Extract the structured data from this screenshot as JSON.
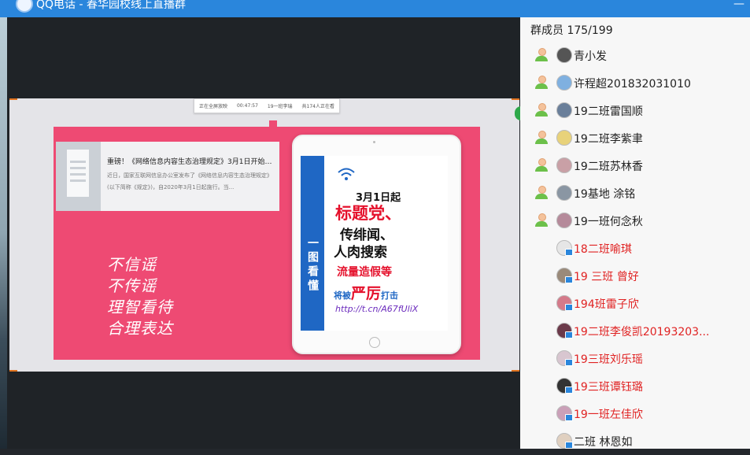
{
  "window": {
    "title": "QQ电话 - 春华园校线上直播群",
    "minimize_glyph": "—"
  },
  "slide": {
    "top_info": [
      "正在全屏放映",
      "00:47:57",
      "19一班李瑞",
      "共174人正在看"
    ],
    "article": {
      "title": "重磅！《网络信息内容生态治理规定》3月1日开始施...",
      "text": "近日，国家互联网信息办公室发布了《网络信息内容生态治理规定》(以下简称《规定》)，自2020年3月1日起施行。当..."
    },
    "handwriting": [
      "不信谣",
      "不传谣",
      "理智看待",
      "合理表达"
    ],
    "banner": "一图看懂",
    "poster": {
      "line1": "3月1日起",
      "line2": "标题党、",
      "line3": "传绯闻、",
      "line4": "人肉搜索",
      "line5": "流量造假等",
      "line6a": "将被",
      "line6b": "严厉",
      "line6c": "打击",
      "url": "http://t.cn/A67fUliX"
    }
  },
  "sidebar": {
    "header": "群成员 175/199",
    "members": [
      {
        "name": "青小发",
        "owner": true,
        "color": "#222222",
        "avatar_color": "#555555"
      },
      {
        "name": "许程超201832031010",
        "owner": true,
        "color": "#222222",
        "avatar_color": "#7fb0e0"
      },
      {
        "name": "19二班雷国顺",
        "owner": true,
        "color": "#222222",
        "avatar_color": "#6a7f9a"
      },
      {
        "name": "19二班李紫聿",
        "owner": true,
        "color": "#222222",
        "avatar_color": "#e8d27a"
      },
      {
        "name": "19二班苏林香",
        "owner": true,
        "color": "#222222",
        "avatar_color": "#c9a0a6"
      },
      {
        "name": "19基地 涂铭",
        "owner": true,
        "color": "#222222",
        "avatar_color": "#8a96a3"
      },
      {
        "name": "19一班何念秋",
        "owner": true,
        "color": "#222222",
        "avatar_color": "#b58a9a"
      },
      {
        "name": "18二班喻琪",
        "owner": false,
        "color": "#e02323",
        "avatar_color": "#e6e6e6"
      },
      {
        "name": "19 三班 曾好",
        "owner": false,
        "color": "#e02323",
        "avatar_color": "#9a8a7a"
      },
      {
        "name": "194班雷子欣",
        "owner": false,
        "color": "#e02323",
        "avatar_color": "#d47a8a"
      },
      {
        "name": "19二班李俊凯20193203...",
        "owner": false,
        "color": "#e02323",
        "avatar_color": "#6b3a4a"
      },
      {
        "name": "19三班刘乐瑶",
        "owner": false,
        "color": "#e02323",
        "avatar_color": "#d8c6d0"
      },
      {
        "name": "19三班谭钰璐",
        "owner": false,
        "color": "#e02323",
        "avatar_color": "#333333"
      },
      {
        "name": "19一班左佳欣",
        "owner": false,
        "color": "#e02323",
        "avatar_color": "#caa0b8"
      },
      {
        "name": "二班 林恩如",
        "owner": false,
        "color": "#222222",
        "avatar_color": "#e0d0c0"
      }
    ]
  },
  "icons": {
    "app": "qq-logo-icon",
    "owner": "member-person-icon",
    "device": "phone-device-icon"
  }
}
